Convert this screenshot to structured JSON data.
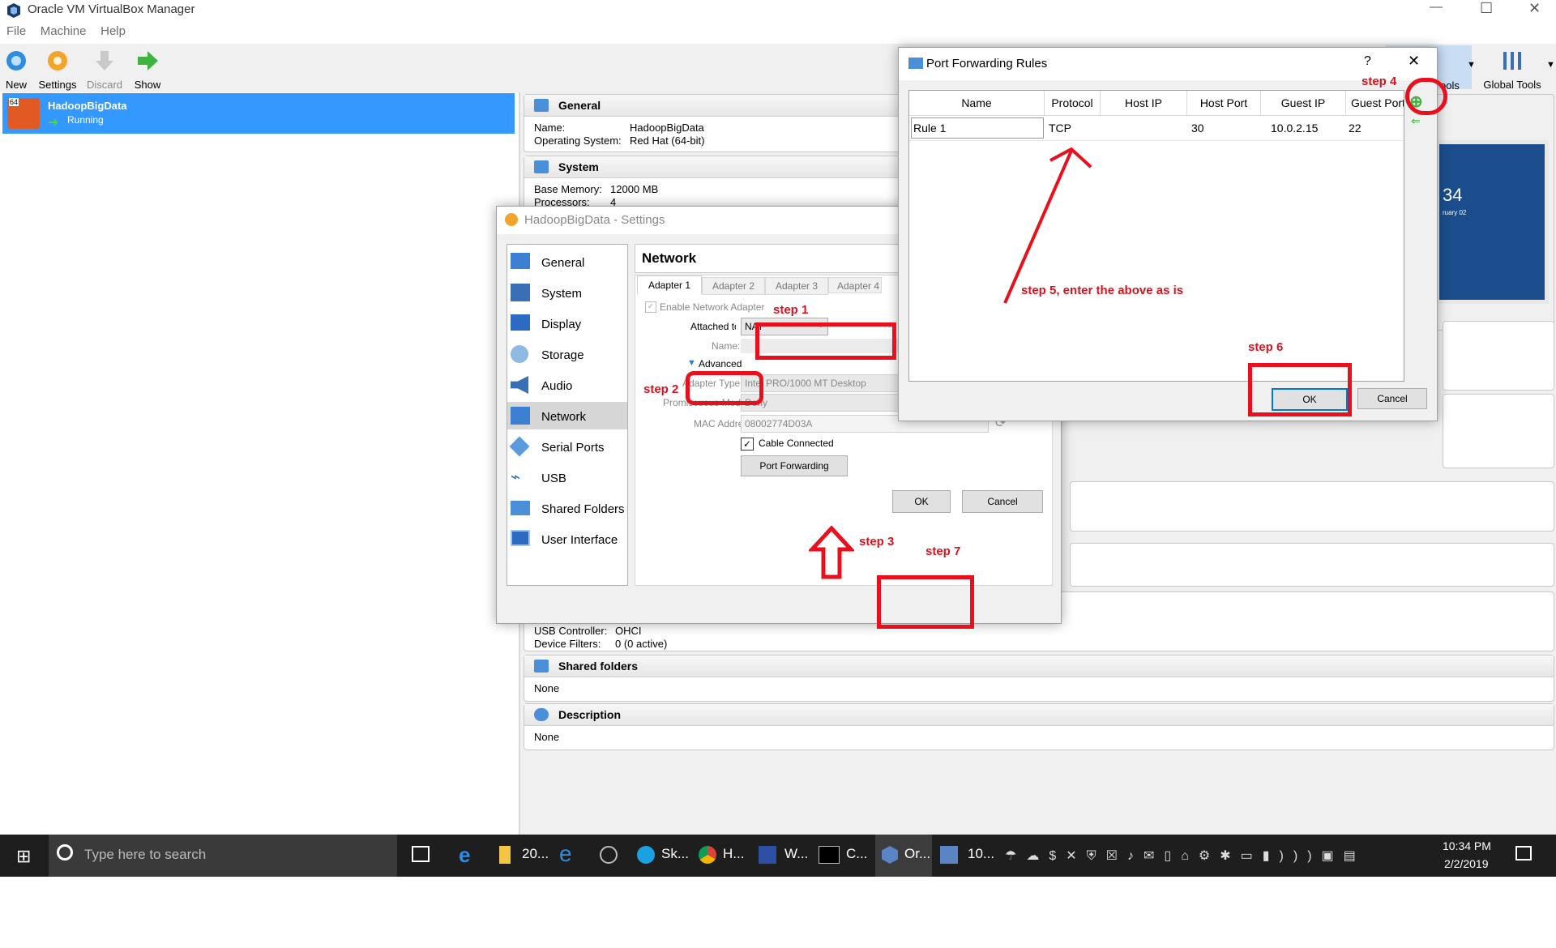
{
  "window": {
    "title": "Oracle VM VirtualBox Manager",
    "min": "—",
    "max": "☐",
    "close": "✕"
  },
  "menu": [
    "File",
    "Machine",
    "Help"
  ],
  "toolbar": {
    "new": "New",
    "settings": "Settings",
    "discard": "Discard",
    "show": "Show",
    "global_tools": "Global Tools",
    "tools_partial": "ools"
  },
  "vm": {
    "badge": "64",
    "name": "HadoopBigData",
    "state": "Running"
  },
  "details": {
    "general": {
      "title": "General",
      "name_k": "Name:",
      "name_v": "HadoopBigData",
      "os_k": "Operating System:",
      "os_v": "Red Hat (64-bit)"
    },
    "system": {
      "title": "System",
      "mem_k": "Base Memory:",
      "mem_v": "12000 MB",
      "proc_k": "Processors:",
      "proc_v": "4"
    },
    "usb": {
      "ctrl_k": "USB Controller:",
      "ctrl_v": "OHCI",
      "filt_k": "Device Filters:",
      "filt_v": "0 (0 active)"
    },
    "shared": {
      "title": "Shared folders",
      "value": "None"
    },
    "description": {
      "title": "Description",
      "value": "None"
    },
    "preview": {
      "big": "34",
      "small": "ruary 02"
    }
  },
  "settings": {
    "title": "HadoopBigData - Settings",
    "nav": [
      "General",
      "System",
      "Display",
      "Storage",
      "Audio",
      "Network",
      "Serial Ports",
      "USB",
      "Shared Folders",
      "User Interface"
    ],
    "heading": "Network",
    "tabs": [
      "Adapter 1",
      "Adapter 2",
      "Adapter 3",
      "Adapter 4"
    ],
    "enable": "Enable Network Adapter",
    "attached_label": "Attached to:",
    "attached_value": "NAT",
    "name_label": "Name:",
    "advanced": "Advanced",
    "adapter_type_label": "Adapter Type:",
    "adapter_type_value": "Intel PRO/1000 MT Desktop",
    "promisc_label": "Promiscuous Mode:",
    "promisc_value": "Deny",
    "mac_label": "MAC Address:",
    "mac_value": "08002774D03A",
    "cable": "Cable Connected",
    "port_forwarding": "Port Forwarding",
    "ok": "OK",
    "cancel": "Cancel"
  },
  "pf": {
    "title": "Port Forwarding Rules",
    "help": "?",
    "columns": [
      "Name",
      "Protocol",
      "Host IP",
      "Host Port",
      "Guest IP",
      "Guest Port"
    ],
    "rows": [
      [
        "Rule 1",
        "TCP",
        "",
        "30",
        "10.0.2.15",
        "22"
      ]
    ],
    "ok": "OK",
    "cancel": "Cancel"
  },
  "annotations": {
    "step1": "step 1",
    "step2": "step 2",
    "step3": "step 3",
    "step4": "step 4",
    "step5": "step 5, enter the above as is",
    "step6": "step 6",
    "step7": "step 7",
    "color": "#d41420"
  },
  "taskbar": {
    "search_placeholder": "Type here to search",
    "apps": [
      "20...",
      "Sk...",
      "H...",
      "W...",
      "C...",
      "Or...",
      "10..."
    ],
    "time": "10:34 PM",
    "date": "2/2/2019"
  }
}
